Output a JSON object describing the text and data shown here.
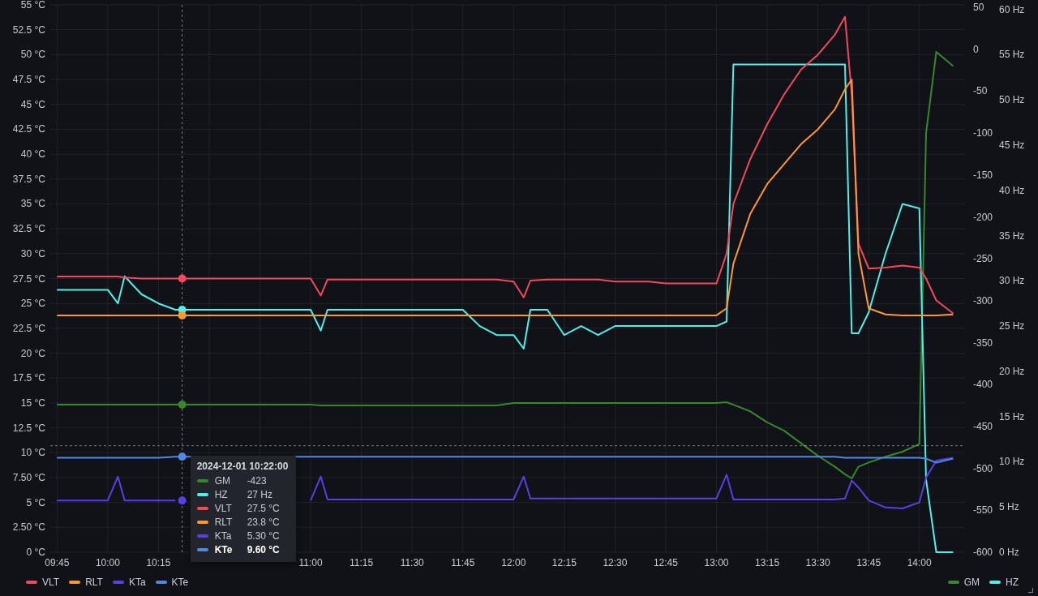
{
  "chart": {
    "chart_data": {
      "type": "line",
      "x": [
        585,
        590,
        595,
        600,
        603,
        605,
        610,
        615,
        620,
        625,
        630,
        635,
        640,
        645,
        650,
        655,
        660,
        663,
        665,
        670,
        675,
        680,
        685,
        690,
        695,
        700,
        705,
        710,
        715,
        720,
        723,
        725,
        730,
        735,
        740,
        745,
        750,
        755,
        760,
        765,
        770,
        775,
        780,
        783,
        785,
        790,
        795,
        800,
        805,
        810,
        815,
        818,
        820,
        822,
        825,
        830,
        835,
        840,
        842,
        845,
        850
      ],
      "xlim": [
        583,
        853.5
      ],
      "xticks": [
        {
          "value": 585,
          "label": "09:45"
        },
        {
          "value": 600,
          "label": "10:00"
        },
        {
          "value": 615,
          "label": "10:15"
        },
        {
          "value": 660,
          "label": "11:00"
        },
        {
          "value": 675,
          "label": "11:15"
        },
        {
          "value": 690,
          "label": "11:30"
        },
        {
          "value": 705,
          "label": "11:45"
        },
        {
          "value": 720,
          "label": "12:00"
        },
        {
          "value": 735,
          "label": "12:15"
        },
        {
          "value": 750,
          "label": "12:30"
        },
        {
          "value": 765,
          "label": "12:45"
        },
        {
          "value": 780,
          "label": "13:00"
        },
        {
          "value": 795,
          "label": "13:15"
        },
        {
          "value": 810,
          "label": "13:30"
        },
        {
          "value": 825,
          "label": "13:45"
        },
        {
          "value": 840,
          "label": "14:00"
        }
      ],
      "ylim": [
        0,
        55
      ],
      "yticks": [
        {
          "value": 0,
          "label": "0 °C"
        },
        {
          "value": 2.5,
          "label": "2.50 °C"
        },
        {
          "value": 5,
          "label": "5 °C"
        },
        {
          "value": 7.5,
          "label": "7.50 °C"
        },
        {
          "value": 10,
          "label": "10 °C"
        },
        {
          "value": 12.5,
          "label": "12.5 °C"
        },
        {
          "value": 15,
          "label": "15 °C"
        },
        {
          "value": 17.5,
          "label": "17.5 °C"
        },
        {
          "value": 20,
          "label": "20 °C"
        },
        {
          "value": 22.5,
          "label": "22.5 °C"
        },
        {
          "value": 25,
          "label": "25 °C"
        },
        {
          "value": 27.5,
          "label": "27.5 °C"
        },
        {
          "value": 30,
          "label": "30 °C"
        },
        {
          "value": 32.5,
          "label": "32.5 °C"
        },
        {
          "value": 35,
          "label": "35 °C"
        },
        {
          "value": 37.5,
          "label": "37.5 °C"
        },
        {
          "value": 40,
          "label": "40 °C"
        },
        {
          "value": 42.5,
          "label": "42.5 °C"
        },
        {
          "value": 45,
          "label": "45 °C"
        },
        {
          "value": 47.5,
          "label": "47.5 °C"
        },
        {
          "value": 50,
          "label": "50 °C"
        },
        {
          "value": 52.5,
          "label": "52.5 °C"
        },
        {
          "value": 55,
          "label": "55 °C"
        }
      ],
      "y2lim": [
        -600,
        53
      ],
      "y2ticks": [
        {
          "value": -600,
          "label": "-600"
        },
        {
          "value": -550,
          "label": "-550"
        },
        {
          "value": -500,
          "label": "-500"
        },
        {
          "value": -450,
          "label": "-450"
        },
        {
          "value": -400,
          "label": "-400"
        },
        {
          "value": -350,
          "label": "-350"
        },
        {
          "value": -300,
          "label": "-300"
        },
        {
          "value": -250,
          "label": "-250"
        },
        {
          "value": -200,
          "label": "-200"
        },
        {
          "value": -150,
          "label": "-150"
        },
        {
          "value": -100,
          "label": "-100"
        },
        {
          "value": -50,
          "label": "-50"
        },
        {
          "value": 0,
          "label": "0"
        },
        {
          "value": 50,
          "label": "50"
        }
      ],
      "y3lim": [
        0,
        60.5
      ],
      "y3ticks": [
        {
          "value": 0,
          "label": "0 Hz"
        },
        {
          "value": 5,
          "label": "5 Hz"
        },
        {
          "value": 10,
          "label": "10 Hz"
        },
        {
          "value": 15,
          "label": "15 Hz"
        },
        {
          "value": 20,
          "label": "20 Hz"
        },
        {
          "value": 25,
          "label": "25 Hz"
        },
        {
          "value": 30,
          "label": "30 Hz"
        },
        {
          "value": 35,
          "label": "35 Hz"
        },
        {
          "value": 40,
          "label": "40 Hz"
        },
        {
          "value": 45,
          "label": "45 Hz"
        },
        {
          "value": 50,
          "label": "50 Hz"
        },
        {
          "value": 55,
          "label": "55 Hz"
        },
        {
          "value": 60,
          "label": "60 Hz"
        }
      ],
      "series": [
        {
          "name": "GM",
          "color": "#37872d",
          "axis": "y2",
          "values": [
            -424,
            -424,
            -424,
            -424,
            -424,
            -424,
            -424,
            -424,
            -424,
            -424,
            -424,
            -424,
            -424,
            -424,
            -424,
            -424,
            -424,
            -425,
            -425,
            -425,
            -425,
            -425,
            -425,
            -425,
            -425,
            -425,
            -425,
            -425,
            -425,
            -422,
            -422,
            -422,
            -422,
            -422,
            -422,
            -422,
            -422,
            -422,
            -422,
            -422,
            -422,
            -422,
            -422,
            -421,
            -424,
            -432,
            -445,
            -455,
            -470,
            -485,
            -498,
            -507,
            -512,
            -498,
            -493,
            -486,
            -480,
            -471,
            -100,
            -3,
            -20
          ]
        },
        {
          "name": "HZ",
          "color": "#4ef0ec",
          "axis": "y3",
          "values": [
            29,
            29,
            29,
            29,
            27.5,
            30.5,
            28.5,
            27.5,
            26.8,
            26.8,
            26.8,
            26.8,
            26.8,
            26.8,
            26.8,
            26.8,
            26.8,
            24.5,
            26.8,
            26.8,
            26.8,
            26.8,
            26.8,
            26.8,
            26.8,
            26.8,
            26.8,
            25,
            24,
            24,
            22.5,
            26.8,
            26.8,
            24,
            25,
            24,
            25,
            25,
            25,
            25,
            25,
            25,
            25,
            25.5,
            53.9,
            53.9,
            53.9,
            53.9,
            53.9,
            53.9,
            53.9,
            53.9,
            24.2,
            24.2,
            26.5,
            33,
            38.5,
            38,
            8,
            0,
            0
          ]
        },
        {
          "name": "VLT",
          "color": "#f2495c",
          "values": [
            27.7,
            27.7,
            27.7,
            27.7,
            27.7,
            27.6,
            27.5,
            27.5,
            27.5,
            27.5,
            27.5,
            27.5,
            27.5,
            27.5,
            27.5,
            27.5,
            27.5,
            25.8,
            27.4,
            27.4,
            27.4,
            27.4,
            27.4,
            27.4,
            27.4,
            27.4,
            27.4,
            27.4,
            27.4,
            27.2,
            25.6,
            27.3,
            27.4,
            27.4,
            27.4,
            27.4,
            27.2,
            27.2,
            27.2,
            27,
            27,
            27,
            27,
            30,
            35,
            39.5,
            43,
            46,
            48.5,
            50,
            52,
            53.8,
            46,
            31,
            28.5,
            28.6,
            28.8,
            28.6,
            27.5,
            25.3,
            24
          ]
        },
        {
          "name": "RLT",
          "color": "#ff9830",
          "values": [
            23.8,
            23.8,
            23.8,
            23.8,
            23.8,
            23.8,
            23.8,
            23.8,
            23.8,
            23.8,
            23.8,
            23.8,
            23.8,
            23.8,
            23.8,
            23.8,
            23.8,
            23.8,
            23.8,
            23.8,
            23.8,
            23.8,
            23.8,
            23.8,
            23.8,
            23.8,
            23.8,
            23.8,
            23.8,
            23.8,
            23.8,
            23.8,
            23.8,
            23.8,
            23.8,
            23.8,
            23.8,
            23.8,
            23.8,
            23.8,
            23.8,
            23.8,
            23.8,
            24.5,
            29,
            34,
            37,
            39,
            41,
            42.5,
            44.5,
            46.5,
            47.5,
            30,
            24.5,
            23.9,
            23.8,
            23.8,
            23.8,
            23.8,
            23.9
          ]
        },
        {
          "name": "KTa",
          "color": "#5b3ee8",
          "values": [
            5.2,
            5.2,
            5.2,
            5.2,
            7.6,
            5.2,
            5.2,
            5.2,
            5.2,
            null,
            null,
            null,
            null,
            null,
            null,
            null,
            5.2,
            7.6,
            5.3,
            5.3,
            5.3,
            5.3,
            5.3,
            5.3,
            5.3,
            5.3,
            5.3,
            5.3,
            5.3,
            5.3,
            7.6,
            5.4,
            5.4,
            5.4,
            5.4,
            5.4,
            5.4,
            5.4,
            5.4,
            5.4,
            5.4,
            5.4,
            5.4,
            7.8,
            5.3,
            5.3,
            5.3,
            5.3,
            5.3,
            5.3,
            5.3,
            5.4,
            7.2,
            6.5,
            5.2,
            4.5,
            4.4,
            5,
            7.5,
            9.2,
            9.5
          ]
        },
        {
          "name": "KTe",
          "color": "#5088e8",
          "values": [
            9.5,
            9.5,
            9.5,
            9.5,
            9.5,
            9.5,
            9.5,
            9.5,
            9.6,
            9.6,
            null,
            null,
            null,
            null,
            null,
            9.6,
            9.6,
            9.6,
            9.6,
            9.6,
            9.6,
            9.6,
            9.6,
            9.6,
            9.6,
            9.6,
            9.6,
            9.6,
            9.6,
            9.6,
            9.6,
            9.6,
            9.6,
            9.6,
            9.6,
            9.6,
            9.6,
            9.6,
            9.6,
            9.6,
            9.6,
            9.6,
            9.6,
            9.6,
            9.6,
            9.6,
            9.6,
            9.6,
            9.6,
            9.6,
            9.6,
            9.5,
            9.5,
            9.5,
            9.5,
            9.5,
            9.5,
            9.5,
            9.4,
            9,
            9.4
          ]
        }
      ],
      "grid": true,
      "ref_lines": [
        {
          "axis": "x",
          "value": 622
        },
        {
          "axis": "y",
          "value": 10.7
        }
      ]
    },
    "tooltip": {
      "title": "2024-12-01 10:22:00",
      "rows": [
        {
          "label": "GM",
          "value": "-423",
          "color": "#37872d",
          "selected": false
        },
        {
          "label": "HZ",
          "value": "27 Hz",
          "color": "#4ef0ec",
          "selected": false
        },
        {
          "label": "VLT",
          "value": "27.5 °C",
          "color": "#f2495c",
          "selected": false
        },
        {
          "label": "RLT",
          "value": "23.8 °C",
          "color": "#ff9830",
          "selected": false
        },
        {
          "label": "KTa",
          "value": "5.30 °C",
          "color": "#5b3ee8",
          "selected": false
        },
        {
          "label": "KTe",
          "value": "9.60 °C",
          "color": "#5088e8",
          "selected": true
        }
      ]
    }
  }
}
